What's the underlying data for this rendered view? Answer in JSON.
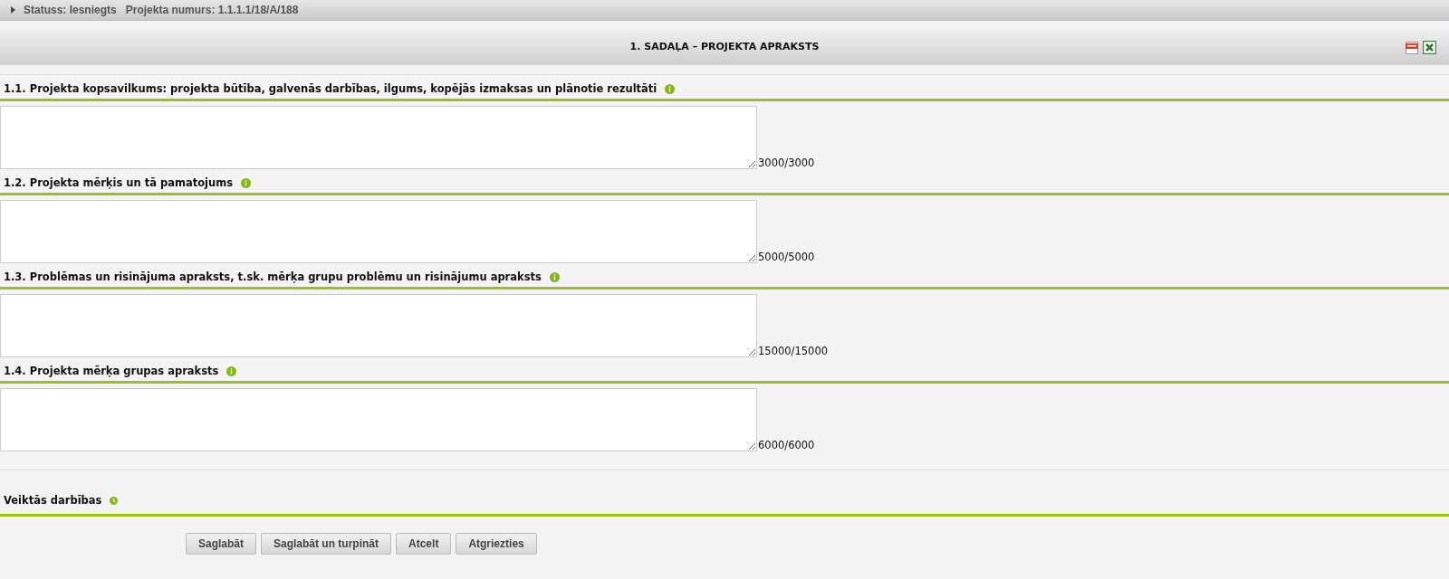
{
  "status_bar": {
    "expanded": false,
    "status": "Statuss: Iesniegts",
    "project_number": "Projekta numurs: 1.1.1.1/18/A/188"
  },
  "section": {
    "title": "1. SADAĻA – PROJEKTA APRAKSTS"
  },
  "fields": [
    {
      "label": "1.1. Projekta kopsavilkums: projekta būtība, galvenās darbības, ilgums, kopējās izmaksas un plānotie rezultāti",
      "counter": "3000/3000"
    },
    {
      "label": "1.2. Projekta mērķis un tā pamatojums",
      "counter": "5000/5000"
    },
    {
      "label": "1.3. Problēmas un risinājuma apraksts, t.sk. mērķa grupu problēmu un risinājumu apraksts",
      "counter": "15000/15000"
    },
    {
      "label": "1.4. Projekta mērķa grupas apraksts",
      "counter": "6000/6000"
    }
  ],
  "history": {
    "label": "Veiktās darbības"
  },
  "buttons": [
    "Saglabāt",
    "Saglabāt un turpināt",
    "Atcelt",
    "Atgriezties"
  ]
}
